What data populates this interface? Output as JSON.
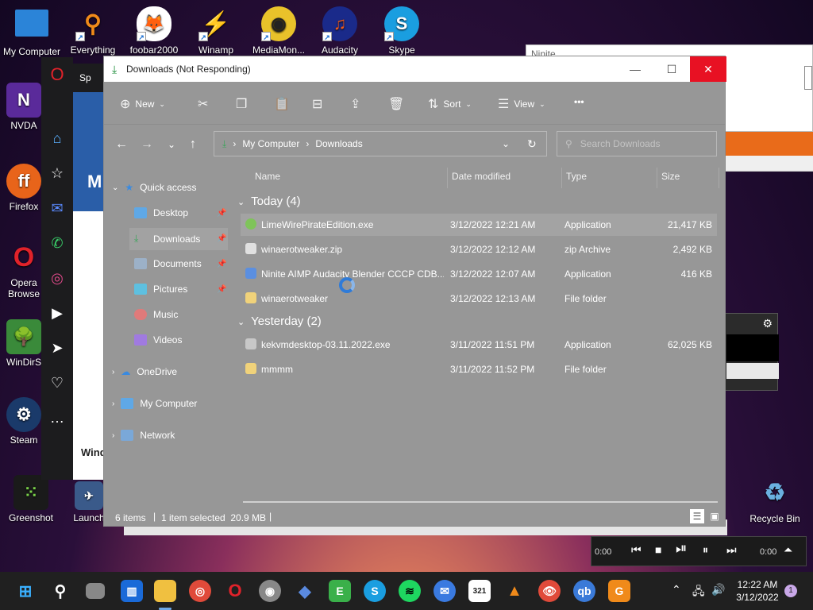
{
  "desktop": {
    "top_icons": [
      {
        "label": "My Computer",
        "icon": "monitor-icon"
      },
      {
        "label": "Everything",
        "icon": "magnifier-icon"
      },
      {
        "label": "foobar2000",
        "icon": "fox-icon"
      },
      {
        "label": "Winamp",
        "icon": "lightning-icon"
      },
      {
        "label": "MediaMon...",
        "icon": "media-monkey-icon"
      },
      {
        "label": "Audacity",
        "icon": "headphones-icon"
      },
      {
        "label": "Skype",
        "icon": "skype-icon"
      }
    ],
    "left_icons": [
      {
        "label": "NVDA",
        "icon": "nvda-icon"
      },
      {
        "label": "Firefox",
        "icon": "firefox-icon"
      },
      {
        "label": "Opera Browse",
        "icon": "opera-icon"
      },
      {
        "label": "WinDirS",
        "icon": "tree-icon"
      },
      {
        "label": "Steam",
        "icon": "steam-icon"
      },
      {
        "label": "Greenshot",
        "icon": "greenshot-icon"
      }
    ],
    "launch_label": "Launch",
    "recycle_bin": "Recycle Bin",
    "ninite_title": "Ninite",
    "opera_tab_label": "Sp",
    "opera_page_letter": "M",
    "opera_page_bottom": "Wind"
  },
  "explorer": {
    "title": "Downloads (Not Responding)",
    "window_controls": {
      "minimize": "—",
      "maximize": "☐",
      "close": "✕"
    },
    "toolbar": {
      "new_label": "New",
      "sort_label": "Sort",
      "view_label": "View",
      "more_label": "•••"
    },
    "address": {
      "crumbs": [
        "My Computer",
        "Downloads"
      ],
      "search_placeholder": "Search Downloads"
    },
    "nav": {
      "quick_access": "Quick access",
      "items": [
        {
          "label": "Desktop",
          "pinned": true,
          "color": "#5fa8e6"
        },
        {
          "label": "Downloads",
          "pinned": true,
          "color": "#3aa55a"
        },
        {
          "label": "Documents",
          "pinned": true,
          "color": "#9cb1c8"
        },
        {
          "label": "Pictures",
          "pinned": true,
          "color": "#5ec0e0"
        },
        {
          "label": "Music",
          "pinned": false,
          "color": "#e07a7a"
        },
        {
          "label": "Videos",
          "pinned": false,
          "color": "#a07ae0"
        }
      ],
      "onedrive": "OneDrive",
      "my_computer": "My Computer",
      "network": "Network"
    },
    "columns": {
      "name": "Name",
      "date": "Date modified",
      "type": "Type",
      "size": "Size"
    },
    "groups": [
      {
        "label": "Today (4)",
        "files": [
          {
            "name": "LimeWirePirateEdition.exe",
            "date": "3/12/2022 12:21 AM",
            "type": "Application",
            "size": "21,417 KB",
            "selected": true,
            "color": "#7fc45a"
          },
          {
            "name": "winaerotweaker.zip",
            "date": "3/12/2022 12:12 AM",
            "type": "zip Archive",
            "size": "2,492 KB",
            "selected": false,
            "color": "#e0e0e0"
          },
          {
            "name": "Ninite AIMP Audacity Blender CCCP CDB...",
            "date": "3/12/2022 12:07 AM",
            "type": "Application",
            "size": "416 KB",
            "selected": false,
            "color": "#5b8fe0"
          },
          {
            "name": "winaerotweaker",
            "date": "3/12/2022 12:13 AM",
            "type": "File folder",
            "size": "",
            "selected": false,
            "color": "#f0d27a"
          }
        ]
      },
      {
        "label": "Yesterday (2)",
        "files": [
          {
            "name": "kekvmdesktop-03.11.2022.exe",
            "date": "3/11/2022 11:51 PM",
            "type": "Application",
            "size": "62,025 KB",
            "selected": false,
            "color": "#c8c8c8"
          },
          {
            "name": "mmmm",
            "date": "3/11/2022 11:52 PM",
            "type": "File folder",
            "size": "",
            "selected": false,
            "color": "#f0d27a"
          }
        ]
      }
    ],
    "status": {
      "items": "6 items",
      "selected": "1 item selected  20.9 MB"
    }
  },
  "player": {
    "time_left": "0:00",
    "time_right": "0:00"
  },
  "taskbar": {
    "time": "12:22 AM",
    "date": "3/12/2022",
    "notifications": "1"
  }
}
